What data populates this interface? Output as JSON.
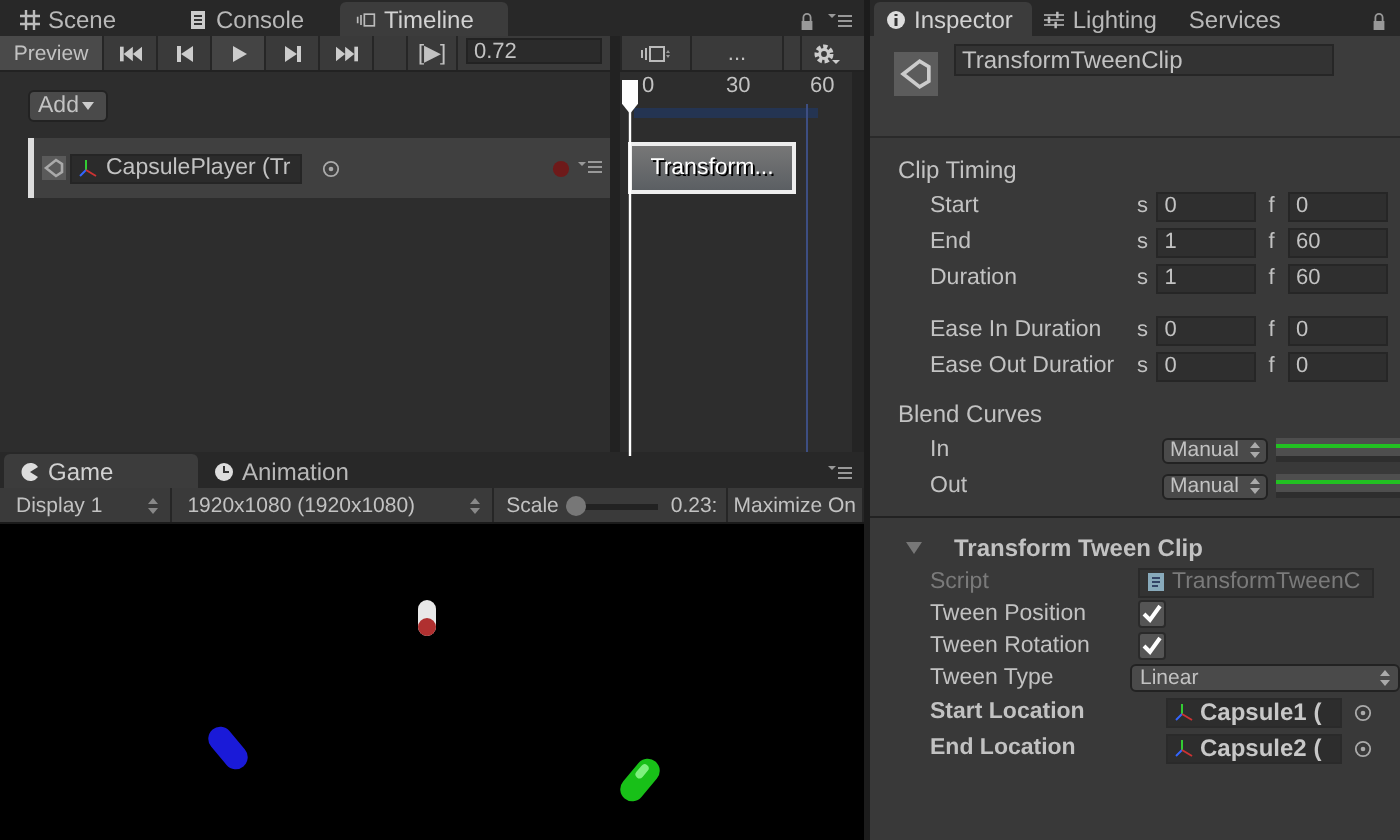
{
  "timeline_panel": {
    "tabs": [
      {
        "label": "Scene",
        "kind": "scene",
        "selected": false
      },
      {
        "label": "Console",
        "kind": "console",
        "selected": false
      },
      {
        "label": "Timeline",
        "kind": "timeline",
        "selected": true
      }
    ],
    "preview_button": "Preview",
    "frame_button": "[▶]",
    "time_field": "0.72",
    "breadcrumb": "...",
    "add_button": "Add",
    "ruler_ticks": [
      "0",
      "30",
      "60"
    ],
    "tracks": [
      {
        "name": "CapsulePlayer (Tr",
        "clip": "Transform..."
      }
    ]
  },
  "game_panel": {
    "tabs": [
      {
        "label": "Game",
        "kind": "game",
        "selected": true
      },
      {
        "label": "Animation",
        "kind": "animation",
        "selected": false
      }
    ],
    "display": "Display 1",
    "resolution": "1920x1080 (1920x1080)",
    "scale_label": "Scale",
    "scale": {
      "level": 0.05
    },
    "scale_value": "0.23:",
    "maximize": "Maximize On"
  },
  "inspector": {
    "tabs": [
      {
        "label": "Inspector",
        "kind": "inspector",
        "selected": true
      },
      {
        "label": "Lighting",
        "kind": "lighting",
        "selected": false
      },
      {
        "label": "Services",
        "kind": "services",
        "selected": false
      }
    ],
    "asset_name": "TransformTweenClip",
    "section_title": "Clip Timing",
    "timing": [
      {
        "label": "Start",
        "s_label": "s",
        "s": "0",
        "f_label": "f",
        "f": "0"
      },
      {
        "label": "End",
        "s_label": "s",
        "s": "1",
        "f_label": "f",
        "f": "60"
      },
      {
        "label": "Duration",
        "s_label": "s",
        "s": "1",
        "f_label": "f",
        "f": "60"
      }
    ],
    "ease": [
      {
        "label": "Ease In Duration",
        "s_label": "s",
        "s": "0",
        "f_label": "f",
        "f": "0"
      },
      {
        "label": "Ease Out Duratior",
        "s_label": "s",
        "s": "0",
        "f_label": "f",
        "f": "0"
      }
    ],
    "blend_title": "Blend Curves",
    "blend": [
      {
        "label": "In",
        "mode": "Manual"
      },
      {
        "label": "Out",
        "mode": "Manual"
      }
    ],
    "component": {
      "title": "Transform Tween Clip",
      "expanded": true,
      "properties": [
        {
          "kind": "script",
          "label": "Script",
          "value": "TransformTweenC",
          "disabled": true,
          "bold": false
        },
        {
          "kind": "checkbox",
          "label": "Tween Position",
          "checked": true,
          "disabled": false,
          "bold": false
        },
        {
          "kind": "checkbox",
          "label": "Tween Rotation",
          "checked": true,
          "disabled": false,
          "bold": false
        },
        {
          "kind": "dropdown",
          "label": "Tween Type",
          "value": "Linear",
          "disabled": false,
          "bold": false
        },
        {
          "kind": "object",
          "label": "Start Location",
          "value": "Capsule1 (",
          "disabled": false,
          "bold": true
        },
        {
          "kind": "object",
          "label": "End Location",
          "value": "Capsule2 (",
          "disabled": false,
          "bold": true
        }
      ]
    }
  }
}
